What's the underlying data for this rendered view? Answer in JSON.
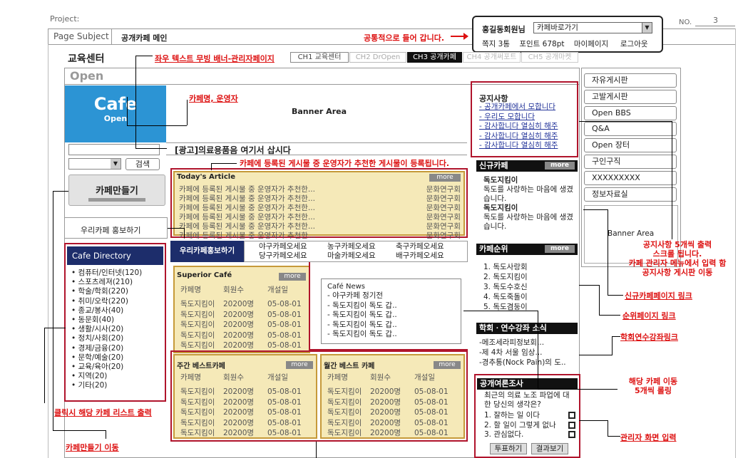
{
  "header": {
    "project_label": "Project:",
    "no_label": "NO.",
    "no_value": "3",
    "page_subject_label": "Page Subject",
    "page_subject_value": "공개카페 메인",
    "note_common": "공통적으로 들어 갑니다."
  },
  "user_box": {
    "name": "홍길동회원님",
    "select_value": "카페바로가기",
    "line2": [
      "쪽지 3통",
      "포인트 678pt",
      "마이페이지",
      "로그아웃"
    ]
  },
  "topbar": {
    "site_title": "교육센터",
    "note_banner": "좌우 텍스트 무빙 배너-관리자페이지",
    "tabs": [
      "CH1 교육센터",
      "CH2 DrOpen",
      "CH3 공개카페",
      "CH4 공개써포트",
      "CH5 공개마켓"
    ]
  },
  "left": {
    "open_label": "Open",
    "logo_title": "Cafe",
    "logo_sub": "Open",
    "search_button": "검색",
    "make_cafe": "카페만들기",
    "make_cafe_sub": "Make Cafe",
    "promo": "우리카페 홍보하기",
    "directory_title": "Cafe Directory",
    "directory": [
      "컴퓨터/인터넷(120)",
      "스포츠레져(210)",
      "학술/학회(220)",
      "취미/오락(220)",
      "종교/봉사(40)",
      "동문회(40)",
      "생활/시사(20)",
      "정치/사회(20)",
      "경제/금융(20)",
      "문학/예술(20)",
      "교육/육아(20)",
      "지역(20)",
      "기타(20)"
    ],
    "note_list": "클릭시 해당 카페 리스트 출력",
    "note_make": "카페만들기 이동"
  },
  "center": {
    "banner": "Banner Area",
    "note_cafename": "카페명, 운영자",
    "ad_text": "[광고]의료용품음 여기서 삽시다",
    "note_recommend": "카페에 등록된 게시물 중 운영자가 추천한 게시물이 등록됩니다.",
    "today_title": "Today's Article",
    "more": "more",
    "today_rows": [
      {
        "t": "카페에 등록된 게시물 중 운영자가 추천한...",
        "c": "문화연구회"
      },
      {
        "t": "카페에 등록된 게시물 중 운영자가 추천한...",
        "c": "문화연구회"
      },
      {
        "t": "카페에 등록된 게시물 중 운영자가 추천한...",
        "c": "문화연구회"
      },
      {
        "t": "카페에 등록된 게시물 중 운영자가 추천한...",
        "c": "문화연구회"
      },
      {
        "t": "카페에 등록된 게시물 중 운영자가 추천한...",
        "c": "문화연구회"
      },
      {
        "t": "카페에 등록된 게시물 중 운영자가 추천한...",
        "c": "문화연구회"
      }
    ],
    "promo_tab": "우리카페홍보하기",
    "promo_links": [
      "야구카페오세요",
      "농구카페오세요",
      "축구카페오세요",
      "당구카페오세요",
      "마술카페오세요",
      "배구카페오세요"
    ],
    "superior_title": "Superior Café",
    "table_headers": [
      "카페명",
      "회원수",
      "개설일"
    ],
    "table_row": [
      "독도지킴이",
      "20200명",
      "05-08-01"
    ],
    "news_title": "Café News",
    "news_items": [
      "- 야구카페 정기전",
      "- 독도지킴이 독도 갑..",
      "- 독도지킴이 독도 갑..",
      "- 독도지킴이 독도 갑..",
      "- 독도지킴이 독도 갑.."
    ],
    "weekly_title": "주간 베스트카페",
    "monthly_title": "월간 베스트 카페"
  },
  "right": {
    "notice_title": "공지사항",
    "notice_items": [
      "- 공개카페에서 모합니다",
      "- 우리도 모합니다",
      "- 감사합니다 열심히 해주",
      "- 감사합니다 열심히 해주",
      "- 감사합니다 열심히 해주"
    ],
    "new_cafe_title": "신규카페",
    "new_cafe": [
      {
        "name": "독도지킴이",
        "desc": "독도를 사랑하는 마음에 생겼습니다."
      },
      {
        "name": "독도지킴이",
        "desc": "독도를 사랑하는 마음에 생겼습니다."
      }
    ],
    "rank_title": "카페순위",
    "rank_items": [
      "1. 독도사랑회",
      "2. 독도지킴이",
      "3. 독도수호신",
      "4. 독도죽돌이",
      "5. 독도겸둥이"
    ],
    "academic_title": "학회ㆍ연수강좌 소식",
    "academic_items": [
      "-메조세라피정보회...",
      "-제 4차 서울 임상...",
      "-경추통(Nock Pain)의 도.."
    ],
    "poll_title": "공개여론조사",
    "poll_question": "최근의 의료 노조 파업에 대한 당신의 생각은?",
    "poll_options": [
      "1. 잘하는 일 이다",
      "2. 할 일이 그렇게 없나",
      "3. 관심없다."
    ],
    "vote_button": "투표하기",
    "result_button": "결과보기"
  },
  "sidebar_menu": [
    "자유게시판",
    "고발게시판",
    "Open BBS",
    "Q&A",
    "Open 장터",
    "구인구직",
    "XXXXXXXXX",
    "정보자료실"
  ],
  "side_banner": "Banner Area",
  "notes": {
    "notice": "공지사항 5개씩 출력\n스크롤 됩니다.\n카페 관리자 메뉴에서 입력 함\n공지사항 게시판 이동",
    "newcafe": "신규카페페이지 링크",
    "rank": "순위페이지 링크",
    "academic": "학회연수강좌링크",
    "cafe_move": "해당 카페 이동\n5개씩 롤링",
    "admin": "관리자 화면 입력"
  }
}
